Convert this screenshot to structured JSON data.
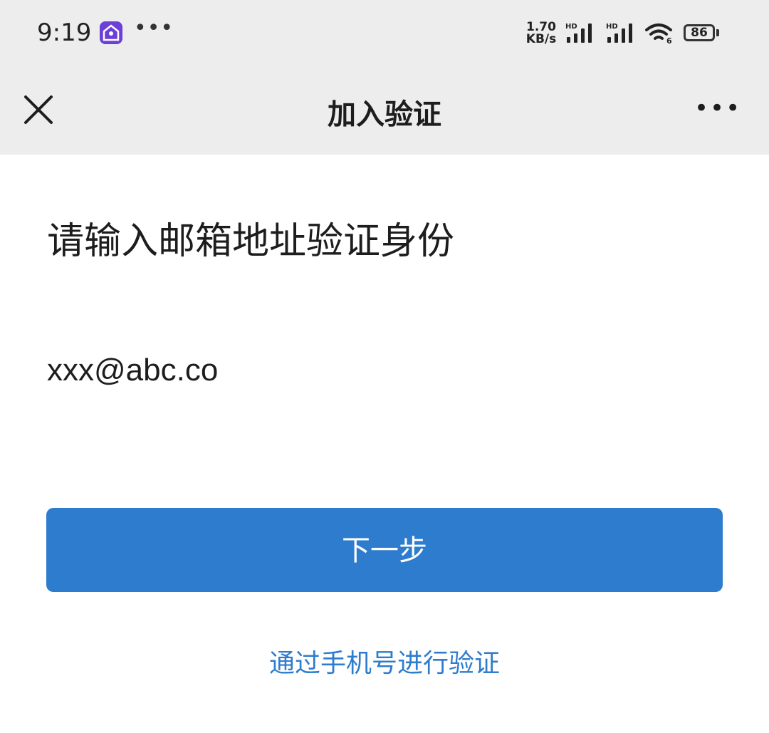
{
  "status_bar": {
    "time": "9:19",
    "more_dots": "•••",
    "net_speed_value": "1.70",
    "net_speed_unit": "KB/s",
    "signal_1_label": "HD",
    "signal_2_label": "HD",
    "wifi_label": "6",
    "battery": "86"
  },
  "nav": {
    "title": "加入验证",
    "more": "•••"
  },
  "main": {
    "heading": "请输入邮箱地址验证身份",
    "email_value": "xxx@abc.co",
    "next_button": "下一步",
    "alt_verify_link": "通过手机号进行验证"
  },
  "colors": {
    "accent": "#2e7ccd",
    "header_bg": "#ededed"
  },
  "icons": [
    "app-badge-icon",
    "signal-icon",
    "wifi-icon",
    "battery-icon",
    "close-icon",
    "more-icon"
  ]
}
